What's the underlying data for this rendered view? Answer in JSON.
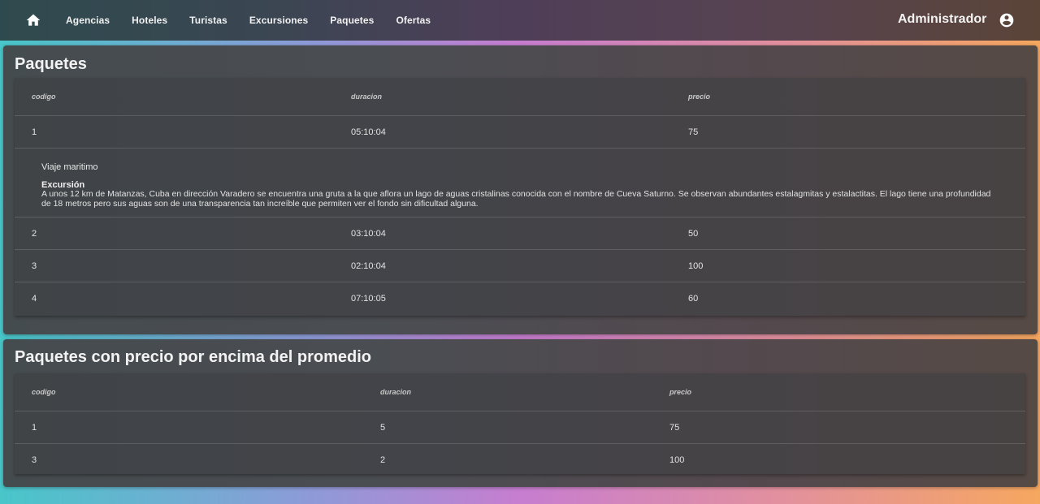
{
  "nav": {
    "items": [
      "Agencias",
      "Hoteles",
      "Turistas",
      "Excursiones",
      "Paquetes",
      "Ofertas"
    ],
    "user_label": "Administrador"
  },
  "paquetes": {
    "title": "Paquetes",
    "headers": [
      "codigo",
      "duracion",
      "precio"
    ],
    "rows": [
      [
        "1",
        "05:10:04",
        "75"
      ],
      [
        "2",
        "03:10:04",
        "50"
      ],
      [
        "3",
        "02:10:04",
        "100"
      ],
      [
        "4",
        "07:10:05",
        "60"
      ]
    ],
    "detail": {
      "name": "Viaje maritimo",
      "type": "Excursión",
      "description": "A unos 12 km de Matanzas, Cuba en dirección Varadero se encuentra una gruta a la que aflora un lago de aguas cristalinas conocida con el nombre de Cueva Saturno. Se observan abundantes estalagmitas y estalactitas. El lago tiene una profundidad de 18 metros pero sus aguas son de una transparencia tan increíble que permiten ver el fondo sin dificultad alguna."
    }
  },
  "promedio": {
    "title": "Paquetes con precio por encima del promedio",
    "headers": [
      "codigo",
      "duracion",
      "precio"
    ],
    "rows": [
      [
        "1",
        "5",
        "75"
      ],
      [
        "3",
        "2",
        "100"
      ]
    ]
  },
  "colors": {
    "accent_gradient": [
      "#48c6c9",
      "#c77dd0",
      "#f6a75f"
    ]
  }
}
